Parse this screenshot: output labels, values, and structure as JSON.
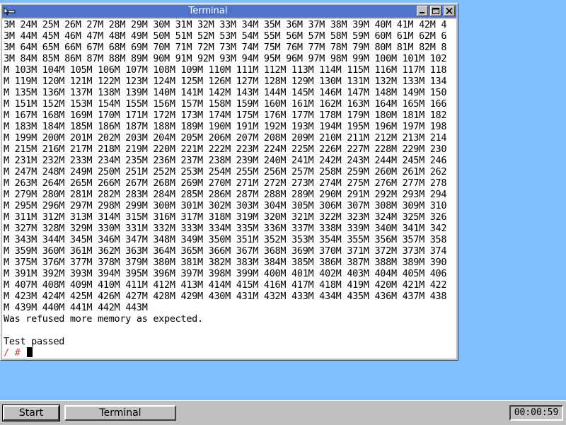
{
  "window": {
    "title": "Terminal"
  },
  "terminal": {
    "lines": [
      "3M 24M 25M 26M 27M 28M 29M 30M 31M 32M 33M 34M 35M 36M 37M 38M 39M 40M 41M 42M 4",
      "3M 44M 45M 46M 47M 48M 49M 50M 51M 52M 53M 54M 55M 56M 57M 58M 59M 60M 61M 62M 6",
      "3M 64M 65M 66M 67M 68M 69M 70M 71M 72M 73M 74M 75M 76M 77M 78M 79M 80M 81M 82M 8",
      "3M 84M 85M 86M 87M 88M 89M 90M 91M 92M 93M 94M 95M 96M 97M 98M 99M 100M 101M 102",
      "M 103M 104M 105M 106M 107M 108M 109M 110M 111M 112M 113M 114M 115M 116M 117M 118",
      "M 119M 120M 121M 122M 123M 124M 125M 126M 127M 128M 129M 130M 131M 132M 133M 134",
      "M 135M 136M 137M 138M 139M 140M 141M 142M 143M 144M 145M 146M 147M 148M 149M 150",
      "M 151M 152M 153M 154M 155M 156M 157M 158M 159M 160M 161M 162M 163M 164M 165M 166",
      "M 167M 168M 169M 170M 171M 172M 173M 174M 175M 176M 177M 178M 179M 180M 181M 182",
      "M 183M 184M 185M 186M 187M 188M 189M 190M 191M 192M 193M 194M 195M 196M 197M 198",
      "M 199M 200M 201M 202M 203M 204M 205M 206M 207M 208M 209M 210M 211M 212M 213M 214",
      "M 215M 216M 217M 218M 219M 220M 221M 222M 223M 224M 225M 226M 227M 228M 229M 230",
      "M 231M 232M 233M 234M 235M 236M 237M 238M 239M 240M 241M 242M 243M 244M 245M 246",
      "M 247M 248M 249M 250M 251M 252M 253M 254M 255M 256M 257M 258M 259M 260M 261M 262",
      "M 263M 264M 265M 266M 267M 268M 269M 270M 271M 272M 273M 274M 275M 276M 277M 278",
      "M 279M 280M 281M 282M 283M 284M 285M 286M 287M 288M 289M 290M 291M 292M 293M 294",
      "M 295M 296M 297M 298M 299M 300M 301M 302M 303M 304M 305M 306M 307M 308M 309M 310",
      "M 311M 312M 313M 314M 315M 316M 317M 318M 319M 320M 321M 322M 323M 324M 325M 326",
      "M 327M 328M 329M 330M 331M 332M 333M 334M 335M 336M 337M 338M 339M 340M 341M 342",
      "M 343M 344M 345M 346M 347M 348M 349M 350M 351M 352M 353M 354M 355M 356M 357M 358",
      "M 359M 360M 361M 362M 363M 364M 365M 366M 367M 368M 369M 370M 371M 372M 373M 374",
      "M 375M 376M 377M 378M 379M 380M 381M 382M 383M 384M 385M 386M 387M 388M 389M 390",
      "M 391M 392M 393M 394M 395M 396M 397M 398M 399M 400M 401M 402M 403M 404M 405M 406",
      "M 407M 408M 409M 410M 411M 412M 413M 414M 415M 416M 417M 418M 419M 420M 421M 422",
      "M 423M 424M 425M 426M 427M 428M 429M 430M 431M 432M 433M 434M 435M 436M 437M 438",
      "M 439M 440M 441M 442M 443M",
      "Was refused more memory as expected.",
      "",
      "Test passed"
    ],
    "prompt": "/ # ",
    "prompt_color": "#d04040"
  },
  "taskbar": {
    "start_label": "Start",
    "task_label": "Terminal",
    "clock": "00:00:59"
  },
  "colors": {
    "desktop": "#7fbfff",
    "titlebar": "#4f74c9",
    "chrome": "#c0c0c0"
  }
}
